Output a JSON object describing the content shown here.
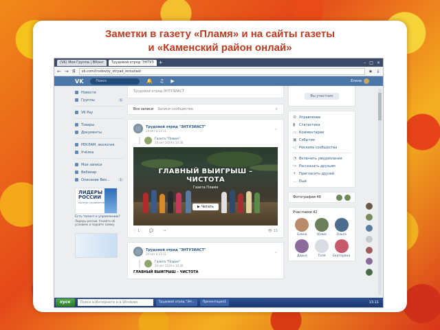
{
  "slide": {
    "title_line1": "Заметки в газету «Пламя» и на сайты газеты",
    "title_line2": "и  «Каменский район онлай»"
  },
  "browser": {
    "tabs": [
      "(VK) Моя Группа | ВКонт",
      "Трудовой отряд 'ЭНТУЗ"
    ],
    "url": "vk.com/trudovoy_otryad_entuziast"
  },
  "vk": {
    "logo": "VK",
    "search_placeholder": "Поиск",
    "user_name": "Елена",
    "left_menu": [
      {
        "label": "Новости"
      },
      {
        "label": "Группы",
        "badge": "6"
      },
      {
        "label": "VK Pay"
      },
      {
        "label": "Товары"
      },
      {
        "label": "Документы"
      },
      {
        "label": "РЕКЛАМ. экология"
      },
      {
        "label": "Учёлка"
      },
      {
        "label": "Мои записи"
      },
      {
        "label": "Вебинар"
      },
      {
        "label": "Описание Вео...",
        "badge": "1"
      }
    ],
    "ad": {
      "head1": "ЛИДЕРЫ",
      "head2": "РОССИИ",
      "sub": "конкурс управленцев",
      "text": "Есть талант к управлению?",
      "small": "Лидеры россии. Узнайте об условиях и подайте заявку"
    },
    "feed": {
      "post_top": "Трудовой отряд ЭНТУЗИАСТ",
      "filter_all": "Все записи",
      "filter_owner": "Записи сообщества",
      "post1": {
        "group": "Трудовой отряд \"ЭНТУЗИАСТ\"",
        "date": "24 окт в 13:11",
        "repost_name": "Газета \"Пламя\"",
        "repost_date": "24 окт 2019 в 10:30",
        "photo_title_1": "ГЛАВНЫЙ ВЫИГРЫШ –",
        "photo_title_2": "ЧИСТОТА",
        "photo_sub": "Газета Пламя",
        "play_label": "▶ Читать",
        "likes": "1",
        "views": "15"
      },
      "post2": {
        "group": "Трудовой отряд \"ЭНТУЗИАСТ\"",
        "date": "24 окт в 13:11",
        "repost_name": "Газета \"Пламя\"",
        "repost_date": "24 окт 2019 в 10:30",
        "text": "ГЛАВНЫЙ ВЫИГРЫШ – ЧИСТОТА"
      }
    },
    "right": {
      "subscribe_label": "Вы участник",
      "menu": [
        {
          "icon": "gear-icon",
          "label": "Управление"
        },
        {
          "icon": "stats-icon",
          "label": "Статистика"
        },
        {
          "icon": "comment-icon",
          "label": "Комментарии"
        },
        {
          "icon": "event-icon",
          "label": "События"
        },
        {
          "icon": "megaphone-icon",
          "label": "Реклама сообщества"
        },
        {
          "icon": "bell-icon",
          "label": "Включить уведомления"
        },
        {
          "icon": "share-icon",
          "label": "Рассказать друзьям"
        },
        {
          "icon": "invite-icon",
          "label": "Пригласить друзей"
        },
        {
          "icon": "more-icon",
          "label": "Ещё"
        }
      ],
      "photos_label": "Фотографии 48",
      "members_title": "Участники 42",
      "members": [
        {
          "name": "Елена",
          "color": "#b98a6a"
        },
        {
          "name": "Юлия",
          "color": "#6a7f5a"
        },
        {
          "name": "Ольга",
          "color": "#4b6c8f"
        },
        {
          "name": "Дарья",
          "color": "#8c6a9a"
        },
        {
          "name": "Толя",
          "color": "#d9dde2"
        },
        {
          "name": "Екатерина",
          "color": "#c65a6a"
        }
      ]
    }
  },
  "taskbar": {
    "start": "пуск",
    "search_placeholder": "Поиск в Интернете и в Windows",
    "items": [
      "Трудовой отряд \"ЭН...",
      "Презентация1"
    ],
    "clock": "13:11"
  },
  "colors": {
    "title": "#c0391e",
    "vk_blue": "#4a76a8",
    "link": "#2a5885"
  }
}
